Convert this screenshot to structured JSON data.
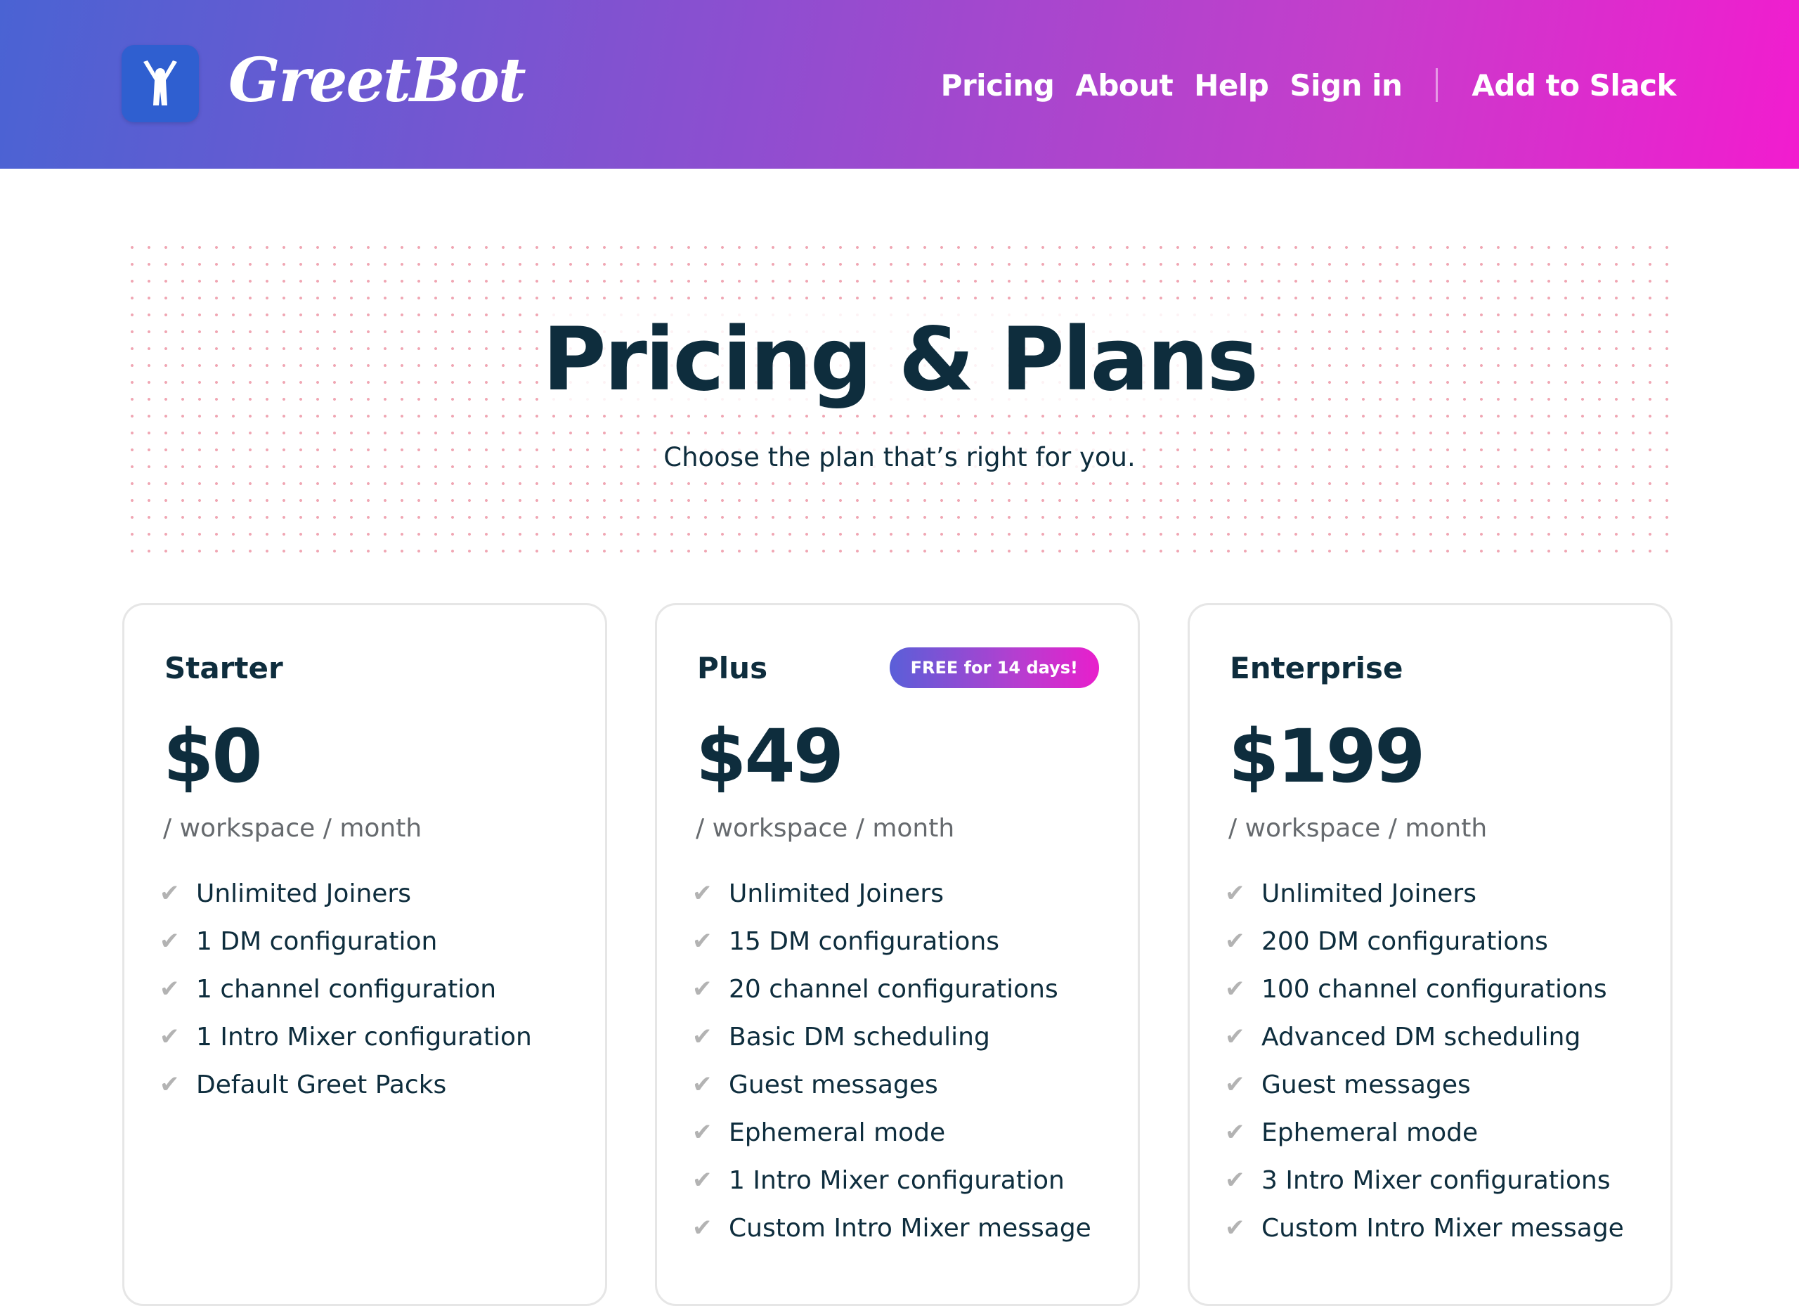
{
  "header": {
    "brand": "GreetBot",
    "logo_icon": "person-arms-up-icon",
    "nav": {
      "pricing": "Pricing",
      "about": "About",
      "help": "Help",
      "sign_in": "Sign in",
      "add_to_slack": "Add to Slack"
    }
  },
  "colors": {
    "header_gradient_start": "#4a63d3",
    "header_gradient_end": "#f21ccf",
    "text_dark": "#0e2d3d",
    "logo_blue": "#2f5fd0",
    "check_gray": "#b3b3b3"
  },
  "hero": {
    "title": "Pricing & Plans",
    "subtitle": "Choose the plan that’s right for you."
  },
  "plans": [
    {
      "name": "Starter",
      "price": "$0",
      "period": "/ workspace / month",
      "features": [
        "Unlimited Joiners",
        "1 DM configuration",
        "1 channel configuration",
        "1 Intro Mixer configuration",
        "Default Greet Packs"
      ]
    },
    {
      "name": "Plus",
      "badge": "FREE for 14 days!",
      "price": "$49",
      "period": "/ workspace / month",
      "features": [
        "Unlimited Joiners",
        "15 DM configurations",
        "20 channel configurations",
        "Basic DM scheduling",
        "Guest messages",
        "Ephemeral mode",
        "1 Intro Mixer configuration",
        "Custom Intro Mixer message"
      ]
    },
    {
      "name": "Enterprise",
      "price": "$199",
      "period": "/ workspace / month",
      "features": [
        "Unlimited Joiners",
        "200 DM configurations",
        "100 channel configurations",
        "Advanced DM scheduling",
        "Guest messages",
        "Ephemeral mode",
        "3 Intro Mixer configurations",
        "Custom Intro Mixer message"
      ]
    }
  ],
  "check_icon": "checkmark-icon",
  "check_glyph": "✔"
}
